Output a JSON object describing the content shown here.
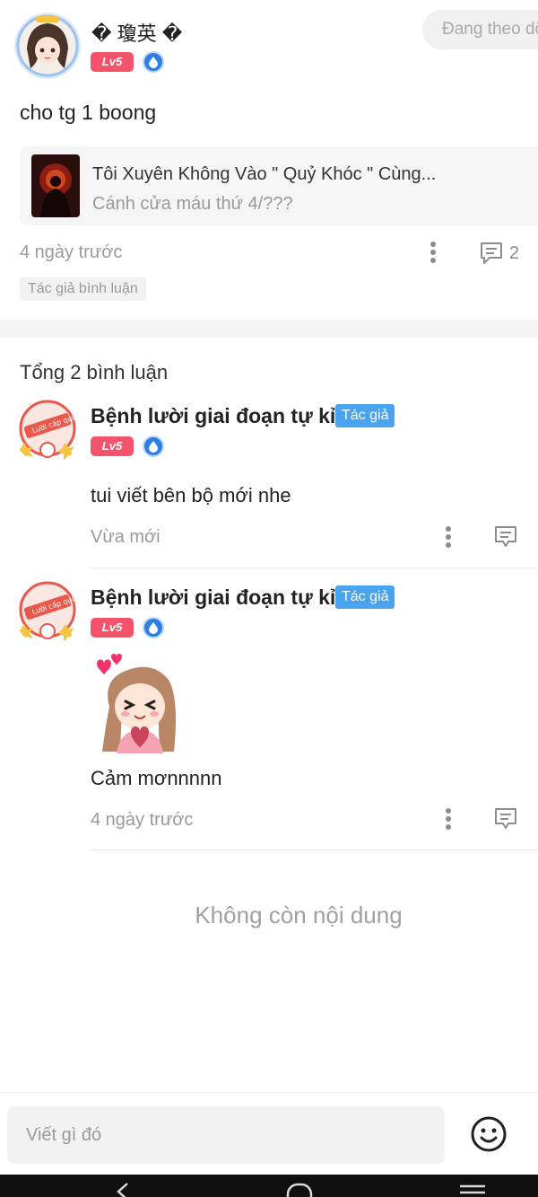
{
  "post": {
    "username": "� 瓊英 �",
    "level": "Lv5",
    "follow_label": "Đang theo dõi",
    "text": "cho tg 1 boong",
    "book": {
      "title": "Tôi Xuyên Không Vào \" Quỷ Khóc \" Cùng...",
      "subtitle": "Cánh cửa máu thứ 4/???"
    },
    "time": "4 ngày trước",
    "comment_count": "2",
    "tag": "Tác giả bình luận"
  },
  "comments_header": "Tổng 2 bình luận",
  "comments": [
    {
      "username": "Bệnh lười giai đoạn tự kỉ",
      "author_badge": "Tác giả",
      "level": "Lv5",
      "text": "tui viết bên bộ mới nhe",
      "time": "Vừa mới"
    },
    {
      "username": "Bệnh lười giai đoạn tự kỉ",
      "author_badge": "Tác giả",
      "level": "Lv5",
      "text": "Cảm mơnnnnn",
      "time": "4 ngày trước"
    }
  ],
  "no_more_label": "Không còn nội dung",
  "input": {
    "placeholder": "Viết gì đó"
  },
  "icons": {
    "more": "more-vertical-icon",
    "comment": "comment-icon",
    "emoji": "emoji-icon",
    "level_drop": "water-drop-icon"
  },
  "colors": {
    "level_badge": "#f4536b",
    "author_badge": "#4aa3ef",
    "drop_badge": "#2f7ee6"
  }
}
